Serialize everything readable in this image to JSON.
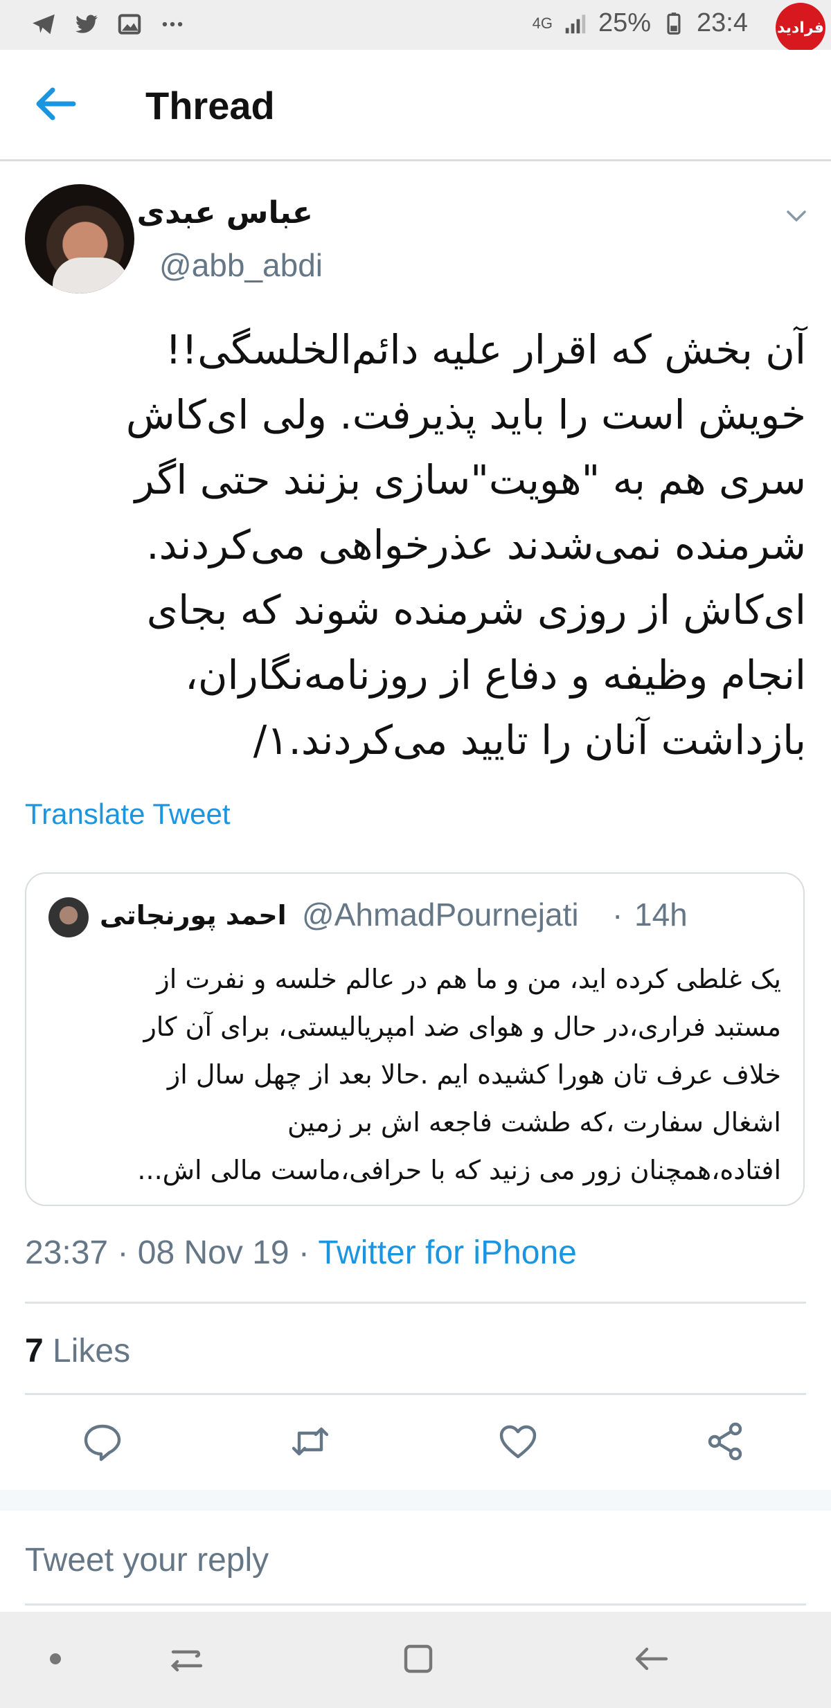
{
  "status_bar": {
    "network": "4G",
    "battery": "25%",
    "time": "23:4",
    "left_icons": [
      "telegram-icon",
      "twitter-icon",
      "gallery-icon",
      "more-icon"
    ],
    "corner_logo": "فرادید"
  },
  "header": {
    "title": "Thread",
    "back_icon": "back-arrow-icon"
  },
  "tweet": {
    "display_name": "عباس عبدی",
    "handle": "@abb_abdi",
    "text_lines": [
      "آن بخش که اقرار علیه دائم‌الخلسگی!!",
      "خویش است را باید پذیرفت. ولی ای‌کاش",
      "سری هم به \"هویت\"سازی بزنند حتی اگر",
      "شرمنده نمی‌شدند عذرخواهی می‌کردند.",
      "ای‌کاش از روزی شرمنده شوند که بجای",
      "انجام وظیفه و دفاع از روزنامه‌نگاران،",
      "بازداشت آنان را تایید می‌کردند.۱/"
    ],
    "translate_label": "Translate Tweet",
    "timestamp": "23:37 · 08 Nov 19 · ",
    "source": "Twitter for iPhone",
    "likes_count": "7",
    "likes_label": " Likes"
  },
  "quoted_tweet": {
    "display_name": "احمد پورنجاتی",
    "handle": "@AhmadPournejati",
    "separator": "·",
    "time": "14h",
    "text_lines": [
      "یک غلطی کرده اید، من و ما هم در عالم خلسه و نفرت از",
      "مستبد فراری،در حال و هوای ضد امپریالیستی، برای آن کار",
      "خلاف عرف تان هورا کشیده ایم .حالا بعد از چهل سال از",
      "اشغال سفارت ،که طشت فاجعه اش بر زمین",
      "افتاده،همچنان زور می زنید که با حرافی،ماست مالی اش..."
    ]
  },
  "actions": [
    "reply-icon",
    "retweet-icon",
    "like-icon",
    "share-icon"
  ],
  "reply": {
    "placeholder": "Tweet your reply"
  },
  "colors": {
    "accent": "#1b95e0",
    "secondary_text": "#657786",
    "corner_logo": "#d7191f"
  }
}
